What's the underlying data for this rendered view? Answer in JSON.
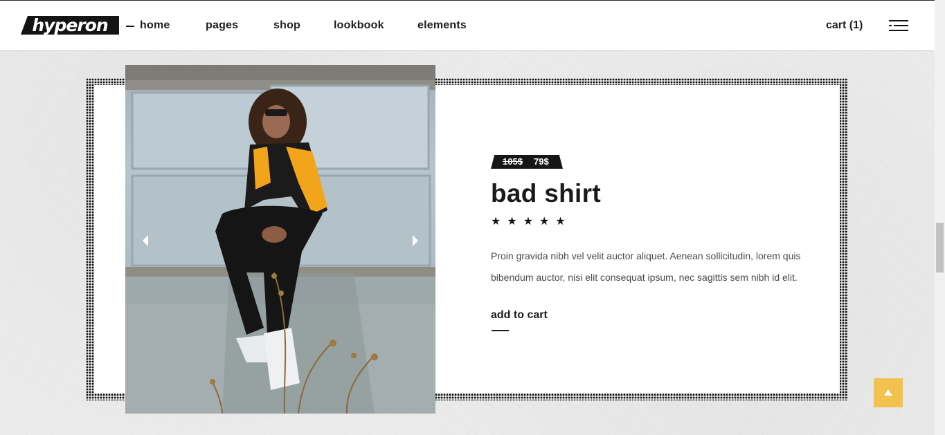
{
  "header": {
    "logo_text": "hyperon",
    "nav": [
      {
        "label": "home"
      },
      {
        "label": "pages"
      },
      {
        "label": "shop"
      },
      {
        "label": "lookbook"
      },
      {
        "label": "elements"
      }
    ],
    "cart_label": "cart (1)",
    "menu_icon": "hamburger-menu-icon"
  },
  "product": {
    "price_old": "105$",
    "price_new": "79$",
    "name": "bad shirt",
    "rating": 5,
    "rating_max": 5,
    "stars": [
      "★",
      "★",
      "★",
      "★",
      "★"
    ],
    "description": "Proin gravida nibh vel velit auctor aliquet. Aenean sollicitudin, lorem quis bibendum auctor, nisi elit consequat ipsum, nec sagittis sem nibh id elit.",
    "add_to_cart": "add to cart",
    "prev_icon": "chevron-left-icon",
    "next_icon": "chevron-right-icon"
  },
  "back_to_top_icon": "arrow-up-icon",
  "colors": {
    "accent": "#f2c14e",
    "text": "#1a1a1a",
    "tag_bg": "#161616"
  }
}
